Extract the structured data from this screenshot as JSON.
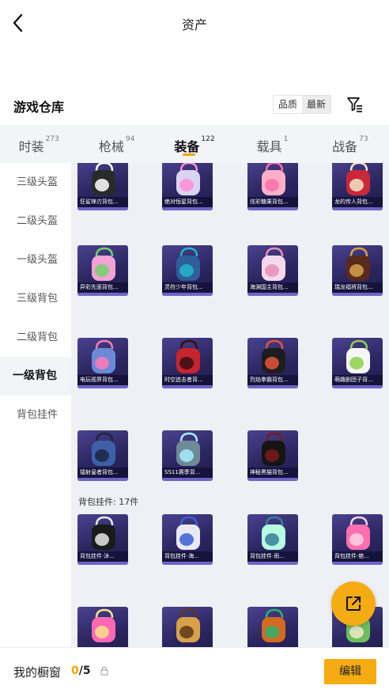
{
  "header": {
    "title": "资产"
  },
  "section": {
    "title": "游戏仓库",
    "sort_options": [
      "品质",
      "最新"
    ]
  },
  "tabs": [
    {
      "label": "时装",
      "count": "273"
    },
    {
      "label": "枪械",
      "count": "94"
    },
    {
      "label": "装备",
      "count": "122"
    },
    {
      "label": "载具",
      "count": "1"
    },
    {
      "label": "战备",
      "count": "73"
    }
  ],
  "sidenav": [
    "三级头盔",
    "二级头盔",
    "一级头盔",
    "三级背包",
    "二级背包",
    "一级背包",
    "背包挂件"
  ],
  "backpacks": [
    "狂鲨锋刃背包...",
    "绝对恒星背包...",
    "炫彩糖果背包...",
    "龙的传人背包...",
    "异彩先驱背包...",
    "灵符少年背包...",
    "海渊国主背包...",
    "瑞龙福将背包...",
    "电玩视界背包...",
    "时空追击者背...",
    "烈焰拳霸背包...",
    "萌趣剧团子背...",
    "镭射皇者背包...",
    "SS11赛季背...",
    "神秘黑猫背包..."
  ],
  "charms_group_label": "背包挂件: 17件",
  "charms": [
    "背包挂件·沐...",
    "背包挂件·海...",
    "背包挂件·雨...",
    "背包挂件·绝..."
  ],
  "bottom": {
    "title": "我的橱窗",
    "current": "0",
    "total": "/5",
    "edit_label": "编辑"
  },
  "colors": {
    "accent": "#f5ab12",
    "card_bg": "#2b2660"
  }
}
